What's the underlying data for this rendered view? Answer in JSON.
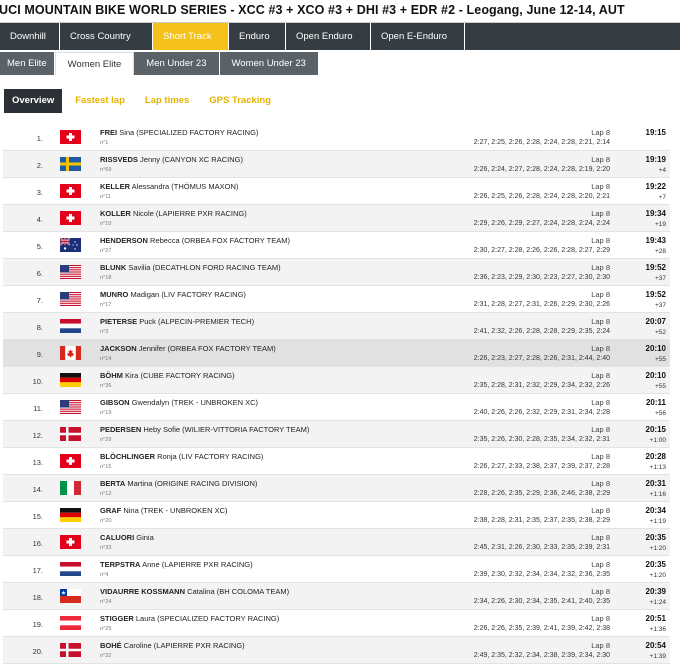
{
  "header": {
    "title": "UCI MOUNTAIN BIKE WORLD SERIES - XCC #3 + XCO #3 + DHI #3 + EDR #2 - Leogang, June 12-14, AUT"
  },
  "discipline_tabs": [
    {
      "label": "Downhill"
    },
    {
      "label": "Cross Country"
    },
    {
      "label": "Short Track"
    },
    {
      "label": "Enduro"
    },
    {
      "label": "Open Enduro"
    },
    {
      "label": "Open E-Enduro"
    }
  ],
  "category_tabs": [
    {
      "label": "Men Elite"
    },
    {
      "label": "Women Elite"
    },
    {
      "label": "Men Under 23"
    },
    {
      "label": "Women Under 23"
    }
  ],
  "view_tabs": [
    {
      "label": "Overview"
    },
    {
      "label": "Fastest lap"
    },
    {
      "label": "Lap times"
    },
    {
      "label": "GPS Tracking"
    }
  ],
  "rows": [
    {
      "rank": "1.",
      "flag": "sui",
      "last": "FREI",
      "first": "Sina",
      "team": "(SPECIALIZED FACTORY RACING)",
      "bib": "n°1",
      "lap": "Lap 8",
      "laps": "2:27, 2:25, 2:26, 2:28, 2:24, 2:28, 2:21, 2:14",
      "time": "19:15",
      "gap": ""
    },
    {
      "rank": "2.",
      "flag": "swe",
      "last": "RISSVEDS",
      "first": "Jenny",
      "team": "(CANYON XC RACING)",
      "bib": "n°69",
      "lap": "Lap 8",
      "laps": "2:26, 2:24, 2:27, 2:28, 2:24, 2:28, 2:19, 2:20",
      "time": "19:19",
      "gap": "+4"
    },
    {
      "rank": "3.",
      "flag": "sui",
      "last": "KELLER",
      "first": "Alessandra",
      "team": "(THÖMUS MAXON)",
      "bib": "n°11",
      "lap": "Lap 8",
      "laps": "2:26, 2:25, 2:26, 2:28, 2:24, 2:28, 2:20, 2:21",
      "time": "19:22",
      "gap": "+7"
    },
    {
      "rank": "4.",
      "flag": "sui",
      "last": "KOLLER",
      "first": "Nicole",
      "team": "(LAPIERRE PXR RACING)",
      "bib": "n°10",
      "lap": "Lap 8",
      "laps": "2:29, 2:26, 2:29, 2:27, 2:24, 2:28, 2:24, 2:24",
      "time": "19:34",
      "gap": "+19"
    },
    {
      "rank": "5.",
      "flag": "aus",
      "last": "HENDERSON",
      "first": "Rebecca",
      "team": "(ORBEA FOX FACTORY TEAM)",
      "bib": "n°27",
      "lap": "Lap 8",
      "laps": "2:30, 2:27, 2:28, 2:26, 2:26, 2:28, 2:27, 2:29",
      "time": "19:43",
      "gap": "+28"
    },
    {
      "rank": "6.",
      "flag": "usa",
      "last": "BLUNK",
      "first": "Savilia",
      "team": "(DECATHLON FORD RACING TEAM)",
      "bib": "n°18",
      "lap": "Lap 8",
      "laps": "2:36, 2:23, 2:29, 2:30, 2:23, 2:27, 2:30, 2:30",
      "time": "19:52",
      "gap": "+37"
    },
    {
      "rank": "7.",
      "flag": "usa",
      "last": "MUNRO",
      "first": "Madigan",
      "team": "(LIV FACTORY RACING)",
      "bib": "n°17",
      "lap": "Lap 8",
      "laps": "2:31, 2:28, 2:27, 2:31, 2:26, 2:29, 2:30, 2:26",
      "time": "19:52",
      "gap": "+37"
    },
    {
      "rank": "8.",
      "flag": "ned",
      "last": "PIETERSE",
      "first": "Puck",
      "team": "(ALPECIN-PREMIER TECH)",
      "bib": "n°3",
      "lap": "Lap 8",
      "laps": "2:41, 2:32, 2:26, 2:28, 2:28, 2:29, 2:35, 2:24",
      "time": "20:07",
      "gap": "+52"
    },
    {
      "rank": "9.",
      "flag": "can",
      "last": "JACKSON",
      "first": "Jennifer",
      "team": "(ORBEA FOX FACTORY TEAM)",
      "bib": "n°14",
      "lap": "Lap 8",
      "laps": "2:26, 2:23, 2:27, 2:28, 2:26, 2:31, 2:44, 2:40",
      "time": "20:10",
      "gap": "+55"
    },
    {
      "rank": "10.",
      "flag": "ger",
      "last": "BÖHM",
      "first": "Kira",
      "team": "(CUBE FACTORY RACING)",
      "bib": "n°36",
      "lap": "Lap 8",
      "laps": "2:35, 2:28, 2:31, 2:32, 2:29, 2:34, 2:32, 2:26",
      "time": "20:10",
      "gap": "+55"
    },
    {
      "rank": "11.",
      "flag": "usa",
      "last": "GIBSON",
      "first": "Gwendalyn",
      "team": "(TREK - UNBROKEN XC)",
      "bib": "n°19",
      "lap": "Lap 8",
      "laps": "2:40, 2:26, 2:26, 2:32, 2:29, 2:31, 2:34, 2:28",
      "time": "20:11",
      "gap": "+56"
    },
    {
      "rank": "12.",
      "flag": "den",
      "last": "PEDERSEN",
      "first": "Heby Sofie",
      "team": "(WILIER-VITTORIA FACTORY TEAM)",
      "bib": "n°29",
      "lap": "Lap 8",
      "laps": "2:35, 2:26, 2:30, 2:28, 2:35, 2:34, 2:32, 2:31",
      "time": "20:15",
      "gap": "+1:00"
    },
    {
      "rank": "13.",
      "flag": "sui",
      "last": "BLÖCHLINGER",
      "first": "Ronja",
      "team": "(LIV FACTORY RACING)",
      "bib": "n°15",
      "lap": "Lap 8",
      "laps": "2:26, 2:27, 2:33, 2:38, 2:37, 2:39, 2:37, 2:28",
      "time": "20:28",
      "gap": "+1:13"
    },
    {
      "rank": "14.",
      "flag": "ita",
      "last": "BERTA",
      "first": "Martina",
      "team": "(ORIGINE RACING DIVISION)",
      "bib": "n°12",
      "lap": "Lap 8",
      "laps": "2:28, 2:26, 2:35, 2:29, 2:36, 2:46, 2:38, 2:29",
      "time": "20:31",
      "gap": "+1:16"
    },
    {
      "rank": "15.",
      "flag": "ger",
      "last": "GRAF",
      "first": "Nina",
      "team": "(TREK - UNBROKEN XC)",
      "bib": "n°20",
      "lap": "Lap 8",
      "laps": "2:38, 2:28, 2:31, 2:35, 2:37, 2:35, 2:38, 2:29",
      "time": "20:34",
      "gap": "+1:19"
    },
    {
      "rank": "16.",
      "flag": "sui",
      "last": "CALUORI",
      "first": "Ginia",
      "team": "",
      "bib": "n°33",
      "lap": "Lap 8",
      "laps": "2:45, 2:31, 2:26, 2:30, 2:33, 2:35, 2:39, 2:31",
      "time": "20:35",
      "gap": "+1:20"
    },
    {
      "rank": "17.",
      "flag": "ned",
      "last": "TERPSTRA",
      "first": "Anne",
      "team": "(LAPIERRE PXR RACING)",
      "bib": "n°4",
      "lap": "Lap 8",
      "laps": "2:39, 2:30, 2:32, 2:34, 2:34, 2:32, 2:36, 2:35",
      "time": "20:35",
      "gap": "+1:20"
    },
    {
      "rank": "18.",
      "flag": "chi",
      "last": "VIDAURRE KOSSMANN",
      "first": "Catalina",
      "team": "(BH COLOMA TEAM)",
      "bib": "n°24",
      "lap": "Lap 8",
      "laps": "2:34, 2:26, 2:30, 2:34, 2:35, 2:41, 2:40, 2:35",
      "time": "20:39",
      "gap": "+1:24"
    },
    {
      "rank": "19.",
      "flag": "aut",
      "last": "STIGGER",
      "first": "Laura",
      "team": "(SPECIALIZED FACTORY RACING)",
      "bib": "n°25",
      "lap": "Lap 8",
      "laps": "2:26, 2:26, 2:35, 2:39, 2:41, 2:39, 2:42, 2:38",
      "time": "20:51",
      "gap": "+1:36"
    },
    {
      "rank": "20.",
      "flag": "den",
      "last": "BOHÉ",
      "first": "Caroline",
      "team": "(LAPIERRE PXR RACING)",
      "bib": "n°32",
      "lap": "Lap 8",
      "laps": "2:49, 2:35, 2:32, 2:34, 2:38, 2:39, 2:34, 2:30",
      "time": "20:54",
      "gap": "+1:39"
    }
  ]
}
